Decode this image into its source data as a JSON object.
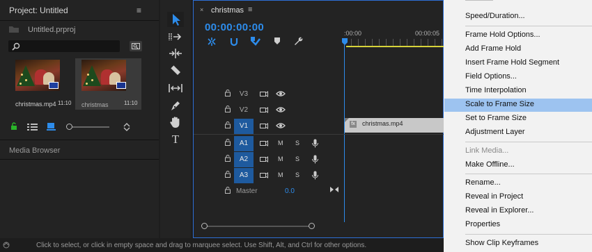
{
  "project": {
    "title": "Project: Untitled",
    "file_name": "Untitled.prproj",
    "search_placeholder": "",
    "clips": [
      {
        "name": "christmas.mp4",
        "duration": "11:10"
      },
      {
        "name": "christmas",
        "duration": "11:10"
      }
    ],
    "media_browser": "Media Browser"
  },
  "timeline": {
    "sequence_name": "christmas",
    "timecode": "00:00:00:00",
    "ruler": {
      "start": ":00:00",
      "mark": "00:00:05"
    },
    "video_tracks": [
      "V3",
      "V2",
      "V1"
    ],
    "audio_tracks": [
      "A1",
      "A2",
      "A3"
    ],
    "audio_m": "M",
    "audio_s": "S",
    "master_label": "Master",
    "master_value": "0.0",
    "clip_name": "christmas.mp4",
    "fx": "fx",
    "targeted_tracks": [
      "V1",
      "A1",
      "A2",
      "A3"
    ],
    "accent": "#2d8ceb"
  },
  "context_menu": {
    "items": [
      {
        "label": "Speed/Duration...",
        "disabled": false
      },
      {
        "label": "Frame Hold Options...",
        "disabled": false
      },
      {
        "label": "Add Frame Hold",
        "disabled": false
      },
      {
        "label": "Insert Frame Hold Segment",
        "disabled": false
      },
      {
        "label": "Field Options...",
        "disabled": false
      },
      {
        "label": "Time Interpolation",
        "disabled": false
      },
      {
        "label": "Scale to Frame Size",
        "disabled": false,
        "highlighted": true
      },
      {
        "label": "Set to Frame Size",
        "disabled": false
      },
      {
        "label": "Adjustment Layer",
        "disabled": false
      },
      {
        "label": "Link Media...",
        "disabled": true
      },
      {
        "label": "Make Offline...",
        "disabled": false
      },
      {
        "label": "Rename...",
        "disabled": false
      },
      {
        "label": "Reveal in Project",
        "disabled": false
      },
      {
        "label": "Reveal in Explorer...",
        "disabled": false
      },
      {
        "label": "Properties",
        "disabled": false
      },
      {
        "label": "Show Clip Keyframes",
        "disabled": false
      }
    ],
    "highlight_color": "#9dc3f0"
  },
  "status_bar": {
    "text": "Click to select, or click in empty space and drag to marquee select. Use Shift, Alt, and Ctrl for other options."
  }
}
